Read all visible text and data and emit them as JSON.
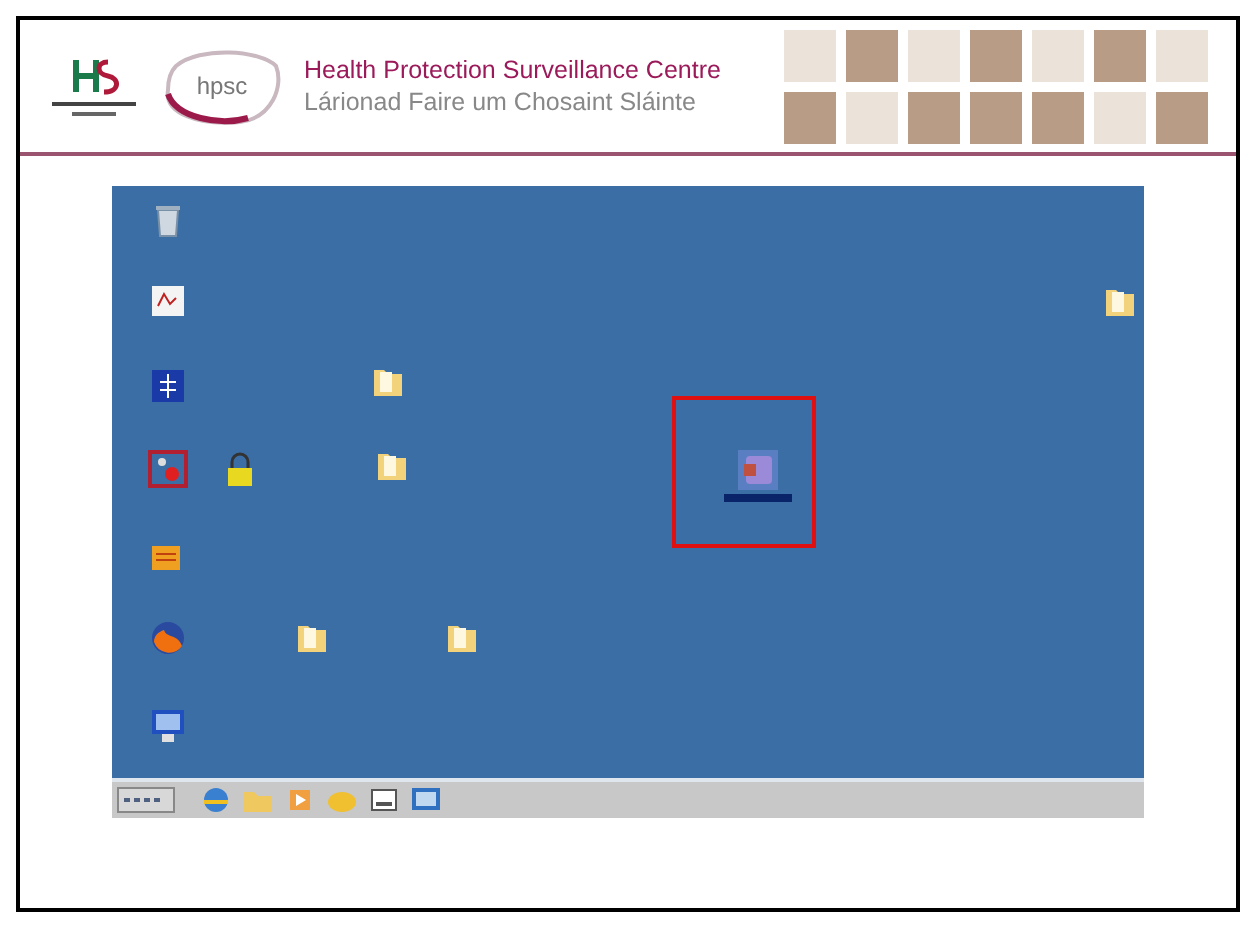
{
  "header": {
    "logo_text": "hpsc",
    "title": "Health Protection Surveillance Centre",
    "subtitle": "Lárionad Faire um Chosaint Sláinte",
    "tiles": [
      {
        "kind": "blank"
      },
      {
        "kind": "photo"
      },
      {
        "kind": "blank"
      },
      {
        "kind": "photo"
      },
      {
        "kind": "blank"
      },
      {
        "kind": "photo"
      },
      {
        "kind": "blank"
      },
      {
        "kind": "photo"
      },
      {
        "kind": "blank"
      },
      {
        "kind": "photo"
      },
      {
        "kind": "photo"
      },
      {
        "kind": "photo"
      },
      {
        "kind": "blank"
      },
      {
        "kind": "photo"
      }
    ]
  },
  "desktop": {
    "icons": [
      {
        "kind": "recycle_bin",
        "selected": false,
        "highlighted": false
      },
      {
        "kind": "pdf",
        "selected": false,
        "highlighted": false
      },
      {
        "kind": "folder",
        "selected": false,
        "highlighted": false
      },
      {
        "kind": "blue_app",
        "selected": false,
        "highlighted": false
      },
      {
        "kind": "folder",
        "selected": false,
        "highlighted": false
      },
      {
        "kind": "red_app",
        "selected": false,
        "highlighted": false
      },
      {
        "kind": "lock",
        "selected": false,
        "highlighted": false
      },
      {
        "kind": "folder",
        "selected": false,
        "highlighted": false
      },
      {
        "kind": "purple_app",
        "selected": true,
        "highlighted": true
      },
      {
        "kind": "orange_app",
        "selected": false,
        "highlighted": false
      },
      {
        "kind": "firefox",
        "selected": false,
        "highlighted": false
      },
      {
        "kind": "folder",
        "selected": false,
        "highlighted": false
      },
      {
        "kind": "folder",
        "selected": false,
        "highlighted": false
      },
      {
        "kind": "monitor",
        "selected": false,
        "highlighted": false
      }
    ],
    "taskbar": {
      "buttons": [
        {
          "kind": "start"
        },
        {
          "kind": "browser"
        },
        {
          "kind": "folder"
        },
        {
          "kind": "media"
        },
        {
          "kind": "gold"
        },
        {
          "kind": "window"
        },
        {
          "kind": "screen"
        }
      ]
    }
  }
}
